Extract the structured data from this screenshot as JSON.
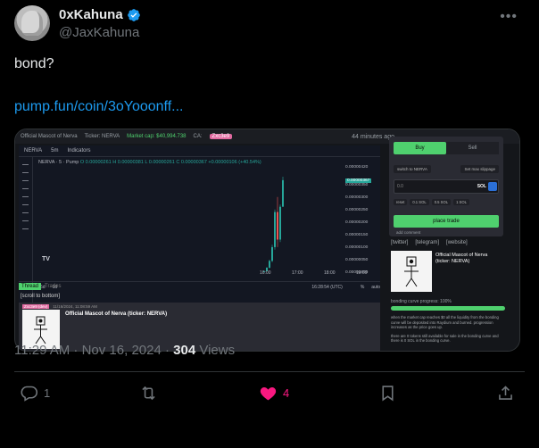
{
  "author": {
    "display_name": "0xKahuna",
    "handle": "@JaxKahuna",
    "verified": true
  },
  "tweet": {
    "text": "bond?",
    "link": "pump.fun/coin/3oYooonff..."
  },
  "embedded_screenshot": {
    "top_bar": {
      "name": "Official Mascot of Nerva",
      "ticker": "Ticker: NERVA",
      "market_cap": "Market cap: $40,994.738",
      "ca": "CA:",
      "creator_tag": "Zxc3e9",
      "ago": "44 minutes ago"
    },
    "chart_toolbar": {
      "symbol": "NERVA",
      "interval": "5m",
      "indicators": "Indicators"
    },
    "legend": {
      "pair": "NERVA · 5 · Pump",
      "ohlc": "O 0.00000261 H 0.00000381 L 0.00000261 C 0.00000367 +0.00000106 (+40.54%)"
    },
    "price_axis": [
      "0.00000420",
      "0.00000367",
      "0.00000350",
      "0.00000300",
      "0.00000250",
      "0.00000200",
      "0.00000150",
      "0.00000100",
      "0.00000050",
      "0.00000000"
    ],
    "time_axis": [
      "16:00",
      "17:00",
      "18:00",
      "19:00"
    ],
    "bottom_bar": {
      "ranges": [
        "5d",
        "1d"
      ],
      "clock": "16:28:54 (UTC)",
      "log": "%",
      "auto": "auto"
    },
    "thread_tabs": [
      "Thread",
      "Trades"
    ],
    "scroll_to_bottom": "[scroll to bottom]",
    "thread_post": {
      "user_tag": "Zxc3e9 (dev)",
      "time": "11/16/2024, 11:08:59 AM",
      "title": "Official Mascot of Nerva (ticker: NERVA)"
    },
    "trade_panel": {
      "buy": "Buy",
      "sell": "Sell",
      "switch": "switch to NERVA",
      "slippage": "Set max slippage",
      "amount_placeholder": "0.0",
      "currency": "SOL",
      "chips": [
        "reset",
        "0.1 SOL",
        "0.5 SOL",
        "1 SOL"
      ],
      "place_trade": "place trade",
      "add_comment": "add comment"
    },
    "links": [
      "[twitter]",
      "[telegram]",
      "[website]"
    ],
    "coin_card_title": "Official Mascot of Nerva (ticker: NERVA)",
    "bonding_curve": {
      "label": "bonding curve progress: 100%",
      "progress": 1.0,
      "text1": "when the market cap reaches $0 all the liquidity from the bonding curve will be deposited into Raydium and burned. progression increases as the price goes up.",
      "text2": "there are 0 tokens still available for sale in the bonding curve and there is 0 SOL in the bonding curve."
    },
    "candles": [
      {
        "t": 0,
        "o": 2e-08,
        "h": 6e-08,
        "l": 1e-08,
        "c": 4e-08
      },
      {
        "t": 1,
        "o": 4e-08,
        "h": 2e-07,
        "l": 3e-08,
        "c": 1.8e-07
      },
      {
        "t": 2,
        "o": 1.8e-07,
        "h": 5e-07,
        "l": 1.5e-07,
        "c": 4.5e-07
      },
      {
        "t": 3,
        "o": 4.5e-07,
        "h": 1.1e-06,
        "l": 4e-07,
        "c": 1e-06
      },
      {
        "t": 4,
        "o": 1e-06,
        "h": 2.5e-06,
        "l": 9e-07,
        "c": 2.4e-06
      },
      {
        "t": 5,
        "o": 2.4e-06,
        "h": 3e-06,
        "l": 1e-06,
        "c": 1.3e-06
      },
      {
        "t": 6,
        "o": 1.3e-06,
        "h": 2.7e-06,
        "l": 1.2e-06,
        "c": 2.61e-06
      },
      {
        "t": 7,
        "o": 2.61e-06,
        "h": 3.81e-06,
        "l": 2.61e-06,
        "c": 3.67e-06
      }
    ],
    "colors": {
      "up": "#26a69a",
      "down": "#ef5350",
      "accent": "#4fd06e"
    }
  },
  "meta": {
    "time": "11:29 AM · Nov 16, 2024 · ",
    "views_count": "304",
    "views_label": " Views"
  },
  "actions": {
    "replies": "1",
    "retweets": "",
    "likes": "4",
    "bookmarks": "",
    "share": ""
  }
}
